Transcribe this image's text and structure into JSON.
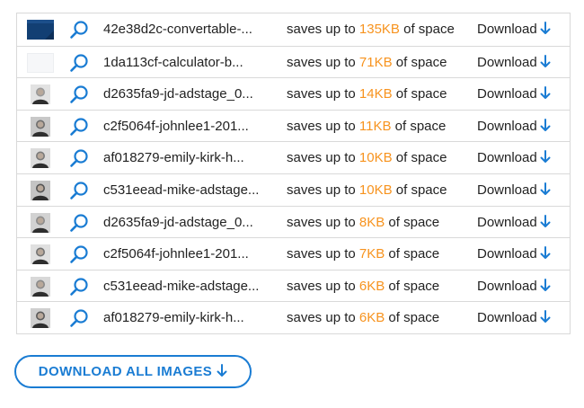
{
  "results": {
    "saves_prefix": "saves up to",
    "saves_suffix": "of space",
    "download_label": "Download",
    "rows": [
      {
        "thumbnail": "blue-banner-thumbnail",
        "filename": "42e38d2c-convertable-...",
        "amount": "135KB"
      },
      {
        "thumbnail": "blank-white-thumbnail",
        "filename": "1da113cf-calculator-b...",
        "amount": "71KB"
      },
      {
        "thumbnail": "portrait-photo-thumbnail",
        "filename": "d2635fa9-jd-adstage_0...",
        "amount": "14KB"
      },
      {
        "thumbnail": "portrait-photo-thumbnail",
        "filename": "c2f5064f-johnlee1-201...",
        "amount": "11KB"
      },
      {
        "thumbnail": "portrait-photo-thumbnail",
        "filename": "af018279-emily-kirk-h...",
        "amount": "10KB"
      },
      {
        "thumbnail": "portrait-photo-thumbnail",
        "filename": "c531eead-mike-adstage...",
        "amount": "10KB"
      },
      {
        "thumbnail": "portrait-photo-thumbnail",
        "filename": "d2635fa9-jd-adstage_0...",
        "amount": "8KB"
      },
      {
        "thumbnail": "portrait-photo-thumbnail",
        "filename": "c2f5064f-johnlee1-201...",
        "amount": "7KB"
      },
      {
        "thumbnail": "portrait-photo-thumbnail",
        "filename": "c531eead-mike-adstage...",
        "amount": "6KB"
      },
      {
        "thumbnail": "portrait-photo-thumbnail",
        "filename": "af018279-emily-kirk-h...",
        "amount": "6KB"
      }
    ]
  },
  "download_all": {
    "label": "DOWNLOAD ALL IMAGES"
  },
  "icons": {
    "zoom": "magnifier-icon",
    "download": "arrow-down-icon"
  },
  "colors": {
    "accent_blue": "#1a7cd3",
    "savings_orange": "#f7931e",
    "border": "#d9d9d9",
    "text": "#222222"
  }
}
